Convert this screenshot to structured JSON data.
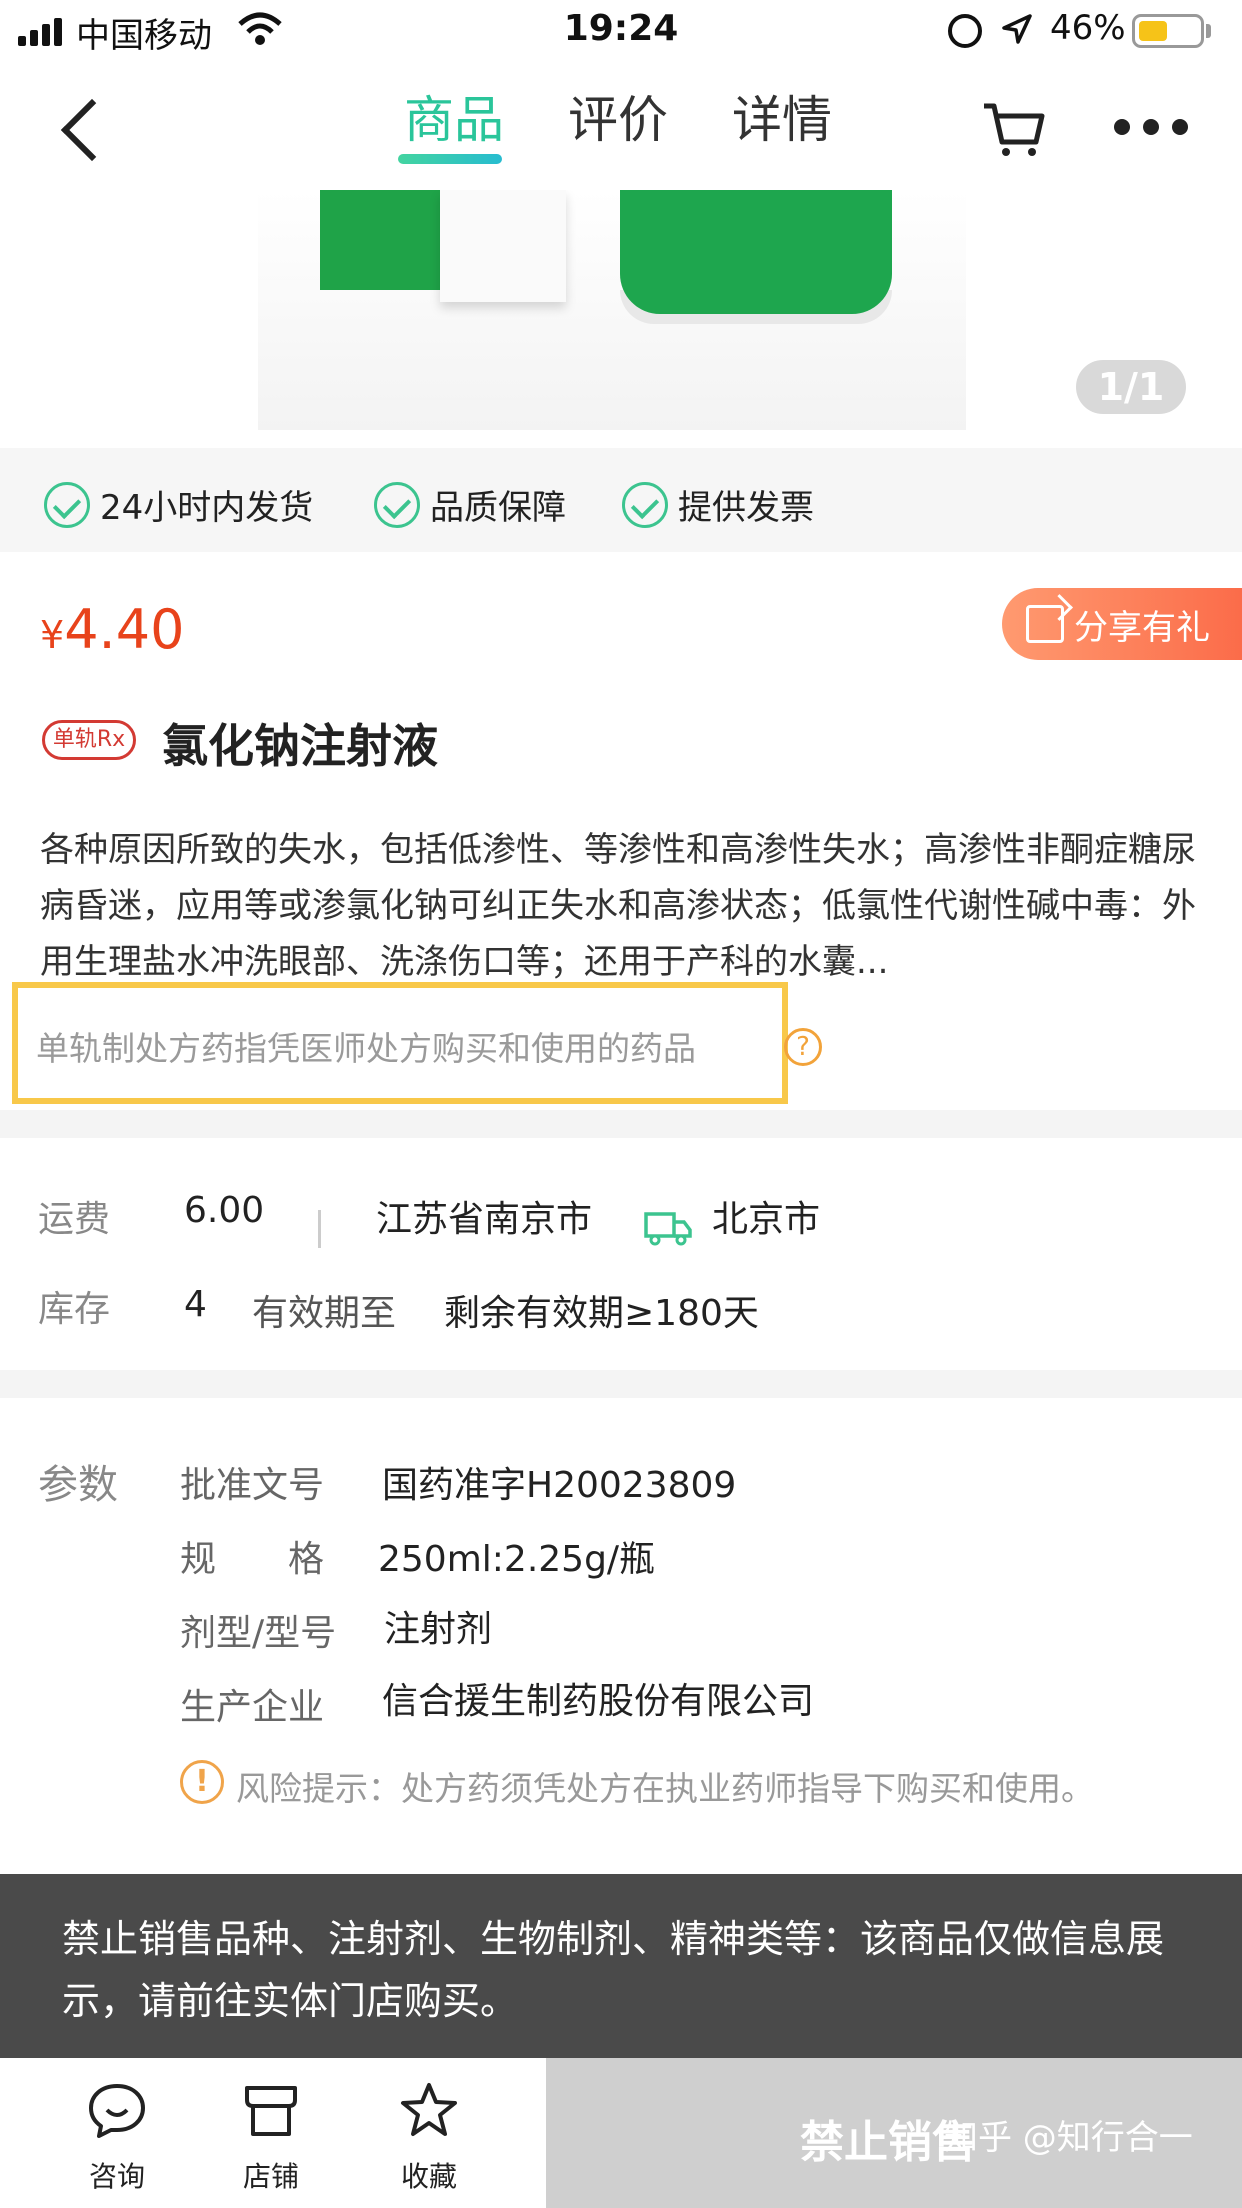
{
  "status_bar": {
    "carrier": "中国移动",
    "time": "19:24",
    "battery": "46%",
    "battery_level": 0.46
  },
  "nav": {
    "tabs": [
      {
        "label": "商品",
        "active": true
      },
      {
        "label": "评价",
        "active": false
      },
      {
        "label": "详情",
        "active": false
      }
    ],
    "accent_color": "#2ac59a"
  },
  "gallery": {
    "counter": "1/1"
  },
  "guarantees": [
    "24小时内发货",
    "品质保障",
    "提供发票"
  ],
  "price": {
    "currency": "¥",
    "amount": "4.40",
    "color": "#e8431b"
  },
  "share": {
    "label": "分享有礼"
  },
  "product": {
    "rx_badge": "单轨Rx",
    "name": "氯化钠注射液",
    "description": "各种原因所致的失水，包括低渗性、等渗性和高渗性失水；高渗性非酮症糖尿病昏迷，应用等或渗氯化钠可纠正失水和高渗状态；低氯性代谢性碱中毒：外用生理盐水冲洗眼部、洗涤伤口等；还用于产科的水囊...",
    "rx_note": "单轨制处方药指凭医师处方购买和使用的药品"
  },
  "shipping": {
    "freight_label": "运费",
    "freight_value": "6.00",
    "origin": "江苏省南京市",
    "destination": "北京市",
    "stock_label": "库存",
    "stock_value": "4",
    "expiry_label": "有效期至",
    "expiry_value": "剩余有效期≥180天"
  },
  "params": {
    "section_label": "参数",
    "rows": [
      {
        "label": "批准文号",
        "value": "国药准字H20023809"
      },
      {
        "label": "规　　格",
        "value": "250ml:2.25g/瓶"
      },
      {
        "label": "剂型/型号",
        "value": "注射剂"
      },
      {
        "label": "生产企业",
        "value": "信合援生制药股份有限公司"
      }
    ],
    "risk_icon": "!",
    "risk_text": "风险提示：处方药须凭处方在执业药师指导下购买和使用。"
  },
  "banner": {
    "text": "禁止销售品种、注射剂、生物制剂、精神类等：该商品仅做信息展示，请前往实体门店购买。"
  },
  "toolbar": {
    "consult": "咨询",
    "store": "店铺",
    "favorite": "收藏",
    "forbid": "禁止销售"
  },
  "watermark": "知乎 @知行合一"
}
